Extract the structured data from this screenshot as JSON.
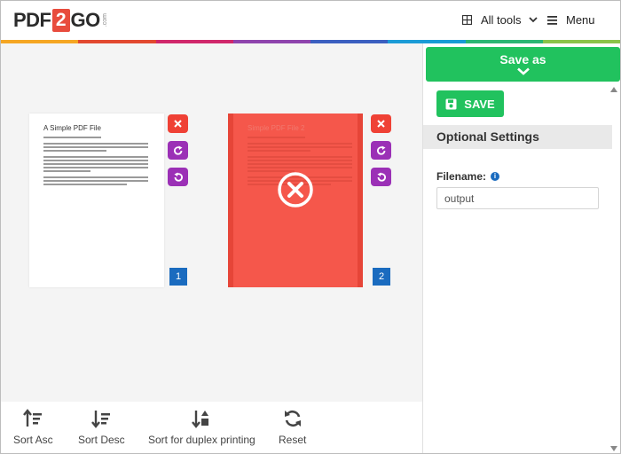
{
  "header": {
    "logo": {
      "part1": "PDF",
      "part2": "2",
      "part3": "GO",
      "suffix": ".com"
    },
    "all_tools_label": "All tools",
    "menu_label": "Menu"
  },
  "rainbow_colors": [
    "#f5a623",
    "#e2492f",
    "#d0276b",
    "#8e44ad",
    "#3b5fc0",
    "#1a9bd6",
    "#2bb673",
    "#8bc34a"
  ],
  "pages": [
    {
      "number": "1",
      "title": "A Simple PDF File",
      "status": "normal"
    },
    {
      "number": "2",
      "title": "Simple PDF File 2",
      "status": "marked-for-deletion"
    }
  ],
  "bottom_tools": [
    {
      "label": "Sort Asc"
    },
    {
      "label": "Sort Desc"
    },
    {
      "label": "Sort for duplex printing"
    },
    {
      "label": "Reset"
    }
  ],
  "sidebar": {
    "save_as_label": "Save as",
    "save_label": "SAVE",
    "optional_settings_title": "Optional Settings",
    "filename_label": "Filename:",
    "filename_value": "output"
  },
  "colors": {
    "green": "#21c25e",
    "red": "#ef4135",
    "purple": "#9b30b6",
    "blue": "#1a6bbf",
    "deleted_page": "#f5574b"
  }
}
